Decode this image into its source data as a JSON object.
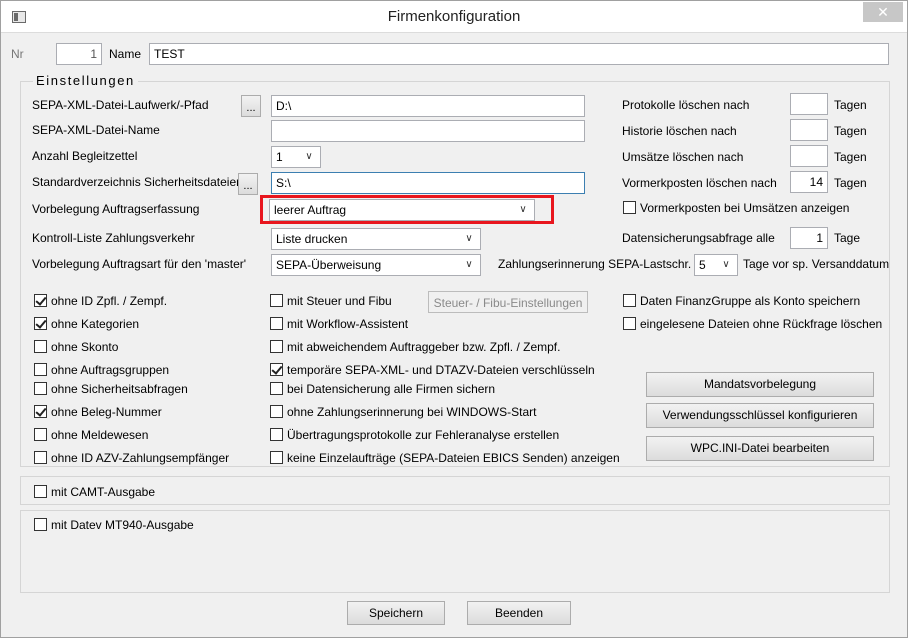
{
  "window": {
    "title": "Firmenkonfiguration",
    "close_symbol": "✕"
  },
  "header": {
    "nr_label": "Nr",
    "nr_value": "1",
    "name_label": "Name",
    "name_value": "TEST"
  },
  "settings": {
    "group_title": "Einstellungen",
    "xml_path_label": "SEPA-XML-Datei-Laufwerk/-Pfad",
    "xml_path_browse": "...",
    "xml_path_value": "D:\\",
    "xml_name_label": "SEPA-XML-Datei-Name",
    "xml_name_value": "",
    "begleitzettel_label": "Anzahl Begleitzettel",
    "begleitzettel_value": "1",
    "safety_dir_label": "Standardverzeichnis Sicherheitsdateien",
    "safety_dir_browse": "...",
    "safety_dir_value": "S:\\",
    "auftrag_label": "Vorbelegung Auftragserfassung",
    "auftrag_value": "leerer Auftrag",
    "kontroll_label": "Kontroll-Liste Zahlungsverkehr",
    "kontroll_value": "Liste drucken",
    "master_label": "Vorbelegung Auftragsart für den 'master'",
    "master_value": "SEPA-Überweisung",
    "reminder_label": "Zahlungserinnerung SEPA-Lastschr.",
    "reminder_value": "5",
    "reminder_suffix": "Tage vor sp. Versanddatum",
    "protokolle_label": "Protokolle löschen nach",
    "protokolle_value": "",
    "protokolle_unit": "Tagen",
    "historie_label": "Historie löschen nach",
    "historie_value": "",
    "historie_unit": "Tagen",
    "umsaetze_label": "Umsätze löschen nach",
    "umsaetze_value": "",
    "umsaetze_unit": "Tagen",
    "vormerk_label": "Vormerkposten löschen nach",
    "vormerk_value": "14",
    "vormerk_unit": "Tagen",
    "vormerk_show_label": "Vormerkposten bei Umsätzen anzeigen",
    "backup_label": "Datensicherungsabfrage alle",
    "backup_value": "1",
    "backup_unit": "Tage"
  },
  "checkboxes": {
    "col1": [
      {
        "label": "ohne ID Zpfl. / Zempf.",
        "checked": true
      },
      {
        "label": "ohne Kategorien",
        "checked": true
      },
      {
        "label": "ohne Skonto",
        "checked": false
      },
      {
        "label": "ohne Auftragsgruppen",
        "checked": false
      },
      {
        "label": "ohne Sicherheitsabfragen",
        "checked": false
      },
      {
        "label": "ohne Beleg-Nummer",
        "checked": true
      },
      {
        "label": "ohne Meldewesen",
        "checked": false
      },
      {
        "label": "ohne ID AZV-Zahlungsempfänger",
        "checked": false
      }
    ],
    "col2": [
      {
        "label": "mit Steuer und Fibu",
        "checked": false
      },
      {
        "label": "mit Workflow-Assistent",
        "checked": false
      },
      {
        "label": "mit abweichendem Auftraggeber bzw. Zpfl. / Zempf.",
        "checked": false
      },
      {
        "label": "temporäre SEPA-XML- und DTAZV-Dateien verschlüsseln",
        "checked": true
      },
      {
        "label": "bei Datensicherung alle Firmen sichern",
        "checked": false
      },
      {
        "label": "ohne Zahlungserinnerung bei WINDOWS-Start",
        "checked": false
      },
      {
        "label": "Übertragungsprotokolle zur Fehleranalyse erstellen",
        "checked": false
      },
      {
        "label": "keine Einzelaufträge (SEPA-Dateien EBICS Senden) anzeigen",
        "checked": false
      }
    ],
    "col3": [
      {
        "label": "Daten FinanzGruppe als Konto speichern",
        "checked": false
      },
      {
        "label": "eingelesene Dateien ohne Rückfrage löschen",
        "checked": false
      }
    ],
    "camt": {
      "label": "mit CAMT-Ausgabe",
      "checked": false
    },
    "datev": {
      "label": "mit Datev MT940-Ausgabe",
      "checked": false
    }
  },
  "buttons": {
    "steuer_fibu": "Steuer- / Fibu-Einstellungen",
    "mandats": "Mandatsvorbelegung",
    "verwendung": "Verwendungsschlüssel konfigurieren",
    "wpcini": "WPC.INI-Datei bearbeiten",
    "save": "Speichern",
    "quit": "Beenden"
  },
  "colors": {
    "highlight": "#e8161e",
    "focus_border": "#3c7fb1"
  }
}
